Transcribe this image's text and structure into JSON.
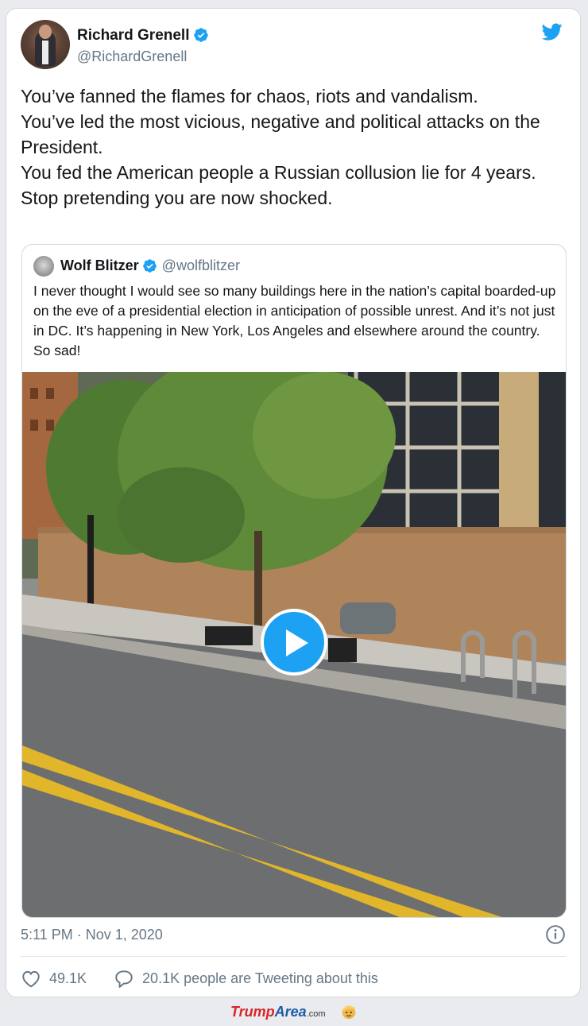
{
  "tweet": {
    "author_name": "Richard Grenell",
    "author_handle": "@RichardGrenell",
    "text_lines": [
      "You’ve fanned the flames for chaos, riots and vandalism.",
      "You’ve led the most vicious, negative and political attacks on the President.",
      "You fed the American people a Russian collusion lie for 4 years.",
      "Stop pretending you are now shocked."
    ],
    "timestamp": "5:11 PM · Nov 1, 2020",
    "likes": "49.1K",
    "retweet_text": "20.1K people are Tweeting about this"
  },
  "quoted": {
    "author_name": "Wolf Blitzer",
    "author_handle": "@wolfblitzer",
    "text": "I never thought I would see so many buildings here in the nation’s capital boarded-up on the eve of a presidential election in anticipation of possible unrest. And it’s not just in DC. It’s happening in New York, Los Angeles and elsewhere around the country. So sad!"
  },
  "footer": {
    "brand_trump": "Trump",
    "brand_area": "Area",
    "brand_com": ".com"
  },
  "colors": {
    "accent": "#1da1f2",
    "text": "#14171a",
    "muted": "#657786"
  },
  "icons": [
    "verified-icon",
    "twitter-bird-icon",
    "play-icon",
    "info-icon",
    "heart-icon",
    "reply-icon"
  ]
}
